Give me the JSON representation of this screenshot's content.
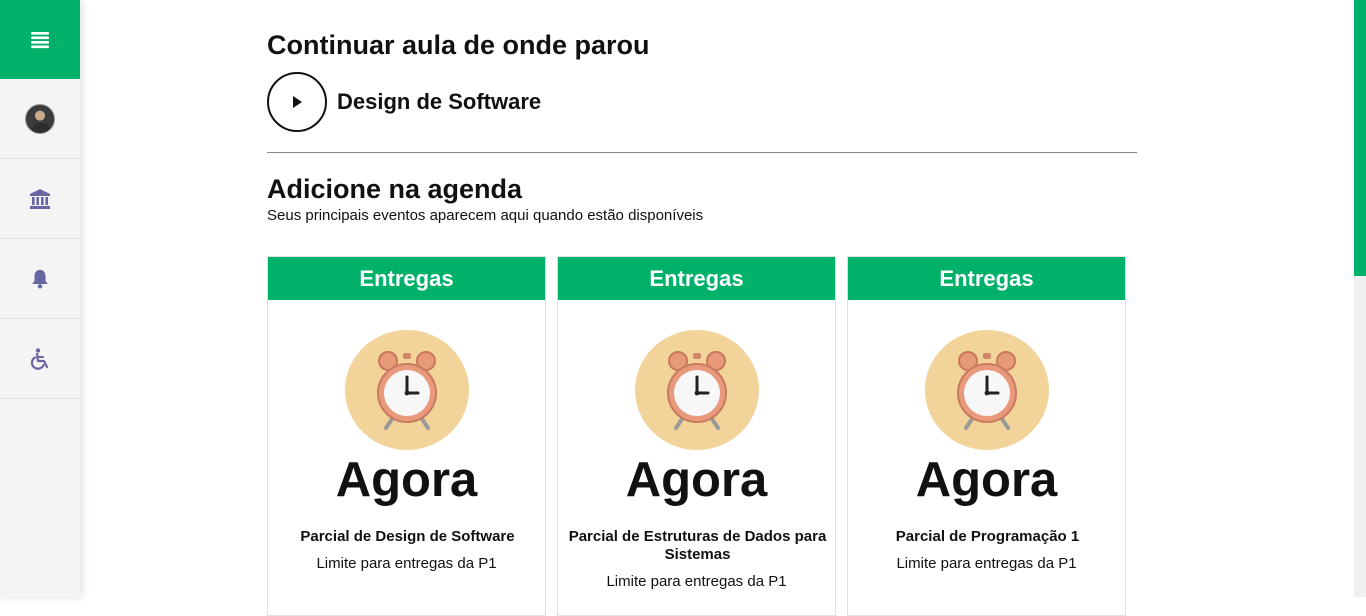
{
  "sidebar": {
    "menu_icon": "menu-icon",
    "items": [
      {
        "name": "profile",
        "icon": "avatar"
      },
      {
        "name": "institution",
        "icon": "bank-icon"
      },
      {
        "name": "notifications",
        "icon": "bell-icon"
      },
      {
        "name": "accessibility",
        "icon": "wheelchair-icon"
      }
    ]
  },
  "continue": {
    "title": "Continuar aula de onde parou",
    "course": "Design de Software"
  },
  "agenda": {
    "title": "Adicione na agenda",
    "subtitle": "Seus principais eventos aparecem aqui quando estão disponíveis",
    "cards": [
      {
        "header": "Entregas",
        "when": "Agora",
        "name": "Parcial de Design de Software",
        "desc": "Limite para entregas da P1"
      },
      {
        "header": "Entregas",
        "when": "Agora",
        "name": "Parcial de Estruturas de Dados para Sistemas",
        "desc": "Limite para entregas da P1"
      },
      {
        "header": "Entregas",
        "when": "Agora",
        "name": "Parcial de Programação 1",
        "desc": "Limite para entregas da P1"
      }
    ]
  },
  "colors": {
    "accent": "#00b16a",
    "icon": "#6a66a3",
    "clock_bg": "#f2d49a"
  }
}
